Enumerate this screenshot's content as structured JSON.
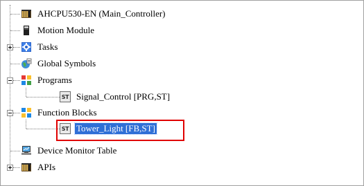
{
  "tree": {
    "items": [
      {
        "label": "AHCPU530-EN  (Main_Controller)",
        "icon": "plc-controller-icon"
      },
      {
        "label": "Motion Module",
        "icon": "module-icon"
      },
      {
        "label": "Tasks",
        "icon": "tasks-icon",
        "expander": "collapsed"
      },
      {
        "label": "Global Symbols",
        "icon": "global-symbols-icon"
      },
      {
        "label": "Programs",
        "icon": "programs-icon",
        "expander": "expanded"
      },
      {
        "label": "Signal_Control [PRG,ST]",
        "icon": "st-icon",
        "badge": "ST"
      },
      {
        "label": "Function Blocks",
        "icon": "function-blocks-icon",
        "expander": "expanded"
      },
      {
        "label": "Tower_Light [FB,ST]",
        "icon": "st-icon",
        "badge": "ST",
        "selected": true
      },
      {
        "label": "Device Monitor Table",
        "icon": "device-monitor-icon"
      },
      {
        "label": "APIs",
        "icon": "apis-icon",
        "expander": "collapsed"
      }
    ]
  },
  "colors": {
    "selection_bg": "#2f6fd6",
    "highlight_border": "#e00000"
  }
}
